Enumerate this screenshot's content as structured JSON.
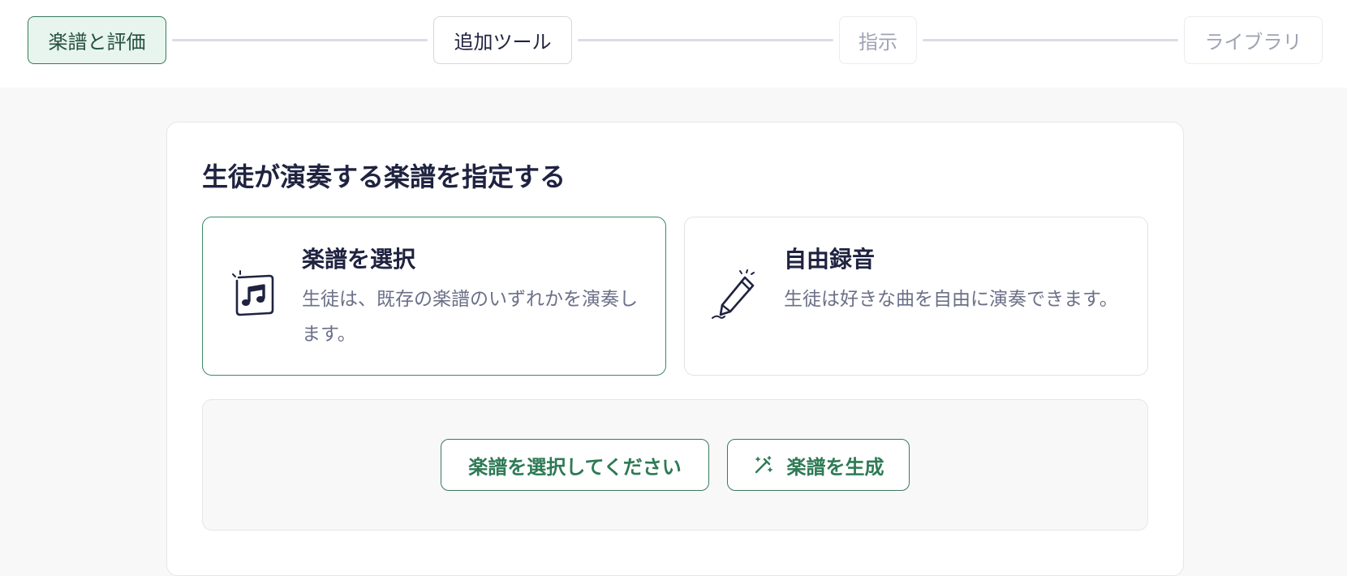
{
  "stepper": {
    "steps": [
      {
        "label": "楽譜と評価",
        "state": "active"
      },
      {
        "label": "追加ツール",
        "state": "current"
      },
      {
        "label": "指示",
        "state": "pending"
      },
      {
        "label": "ライブラリ",
        "state": "pending"
      }
    ]
  },
  "main": {
    "title": "生徒が演奏する楽譜を指定する",
    "options": [
      {
        "title": "楽譜を選択",
        "description": "生徒は、既存の楽譜のいずれかを演奏します。",
        "icon": "music-sheet-icon",
        "selected": true
      },
      {
        "title": "自由録音",
        "description": "生徒は好きな曲を自由に演奏できます。",
        "icon": "pencil-icon",
        "selected": false
      }
    ],
    "actions": {
      "select_label": "楽譜を選択してください",
      "generate_label": "楽譜を生成",
      "generate_icon": "magic-wand-icon"
    }
  },
  "colors": {
    "accent": "#3a7a5c",
    "accent_bg": "#e8f4ee",
    "text_primary": "#1f2340",
    "text_muted": "#6b7088"
  }
}
